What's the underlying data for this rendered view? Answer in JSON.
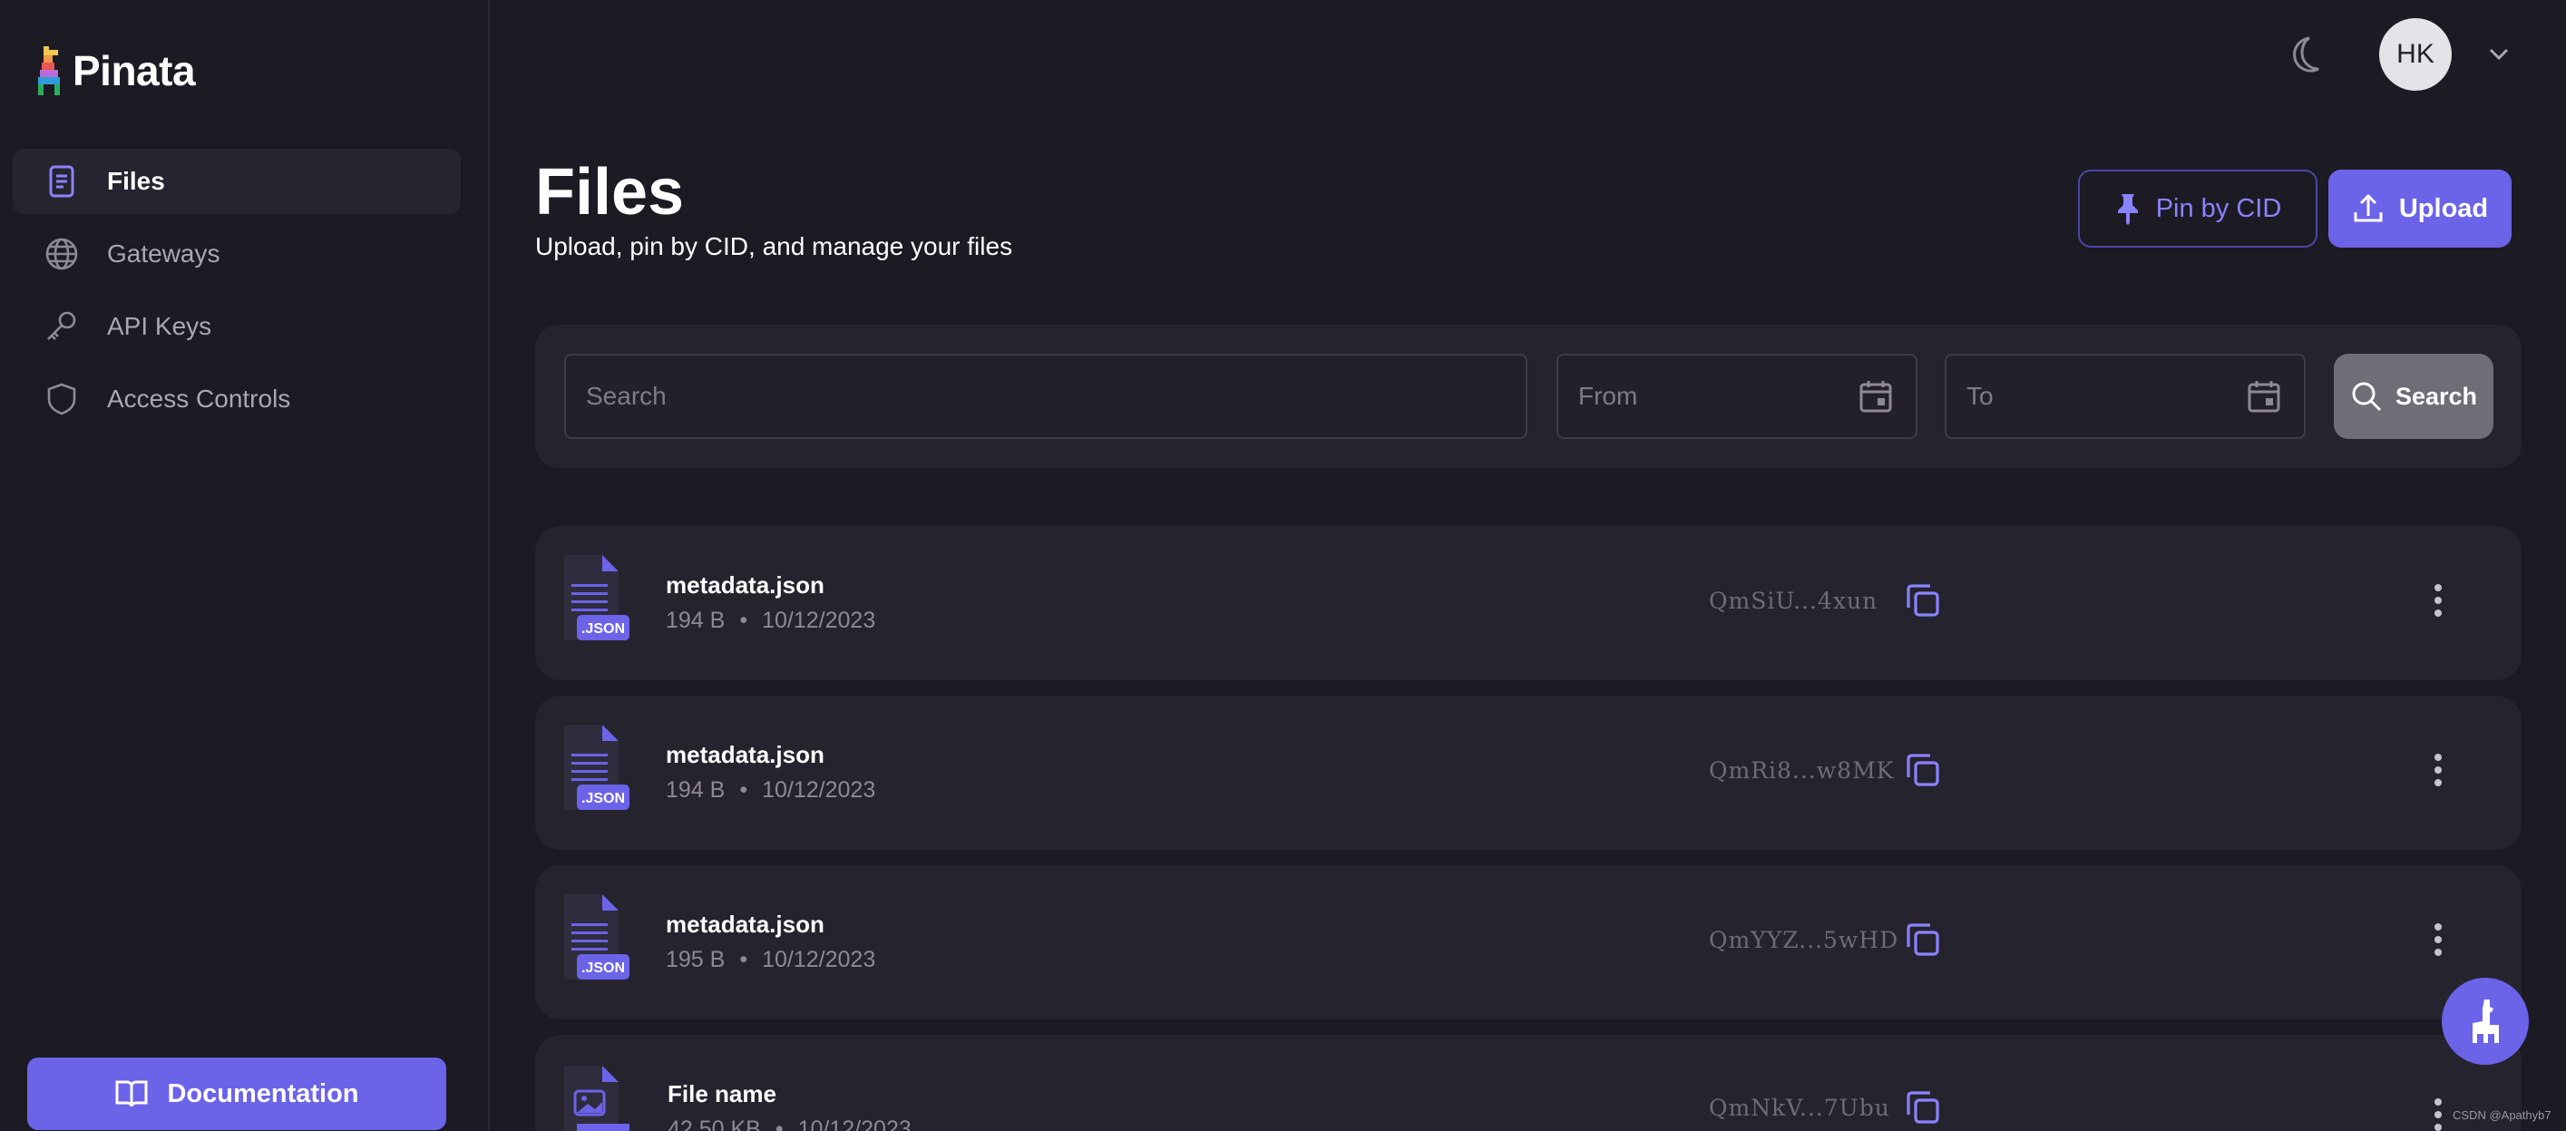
{
  "app": {
    "brand": "Pinata"
  },
  "sidebar": {
    "items": [
      {
        "label": "Files",
        "icon": "file-icon",
        "active": true
      },
      {
        "label": "Gateways",
        "icon": "globe-icon",
        "active": false
      },
      {
        "label": "API Keys",
        "icon": "key-icon",
        "active": false
      },
      {
        "label": "Access Controls",
        "icon": "shield-icon",
        "active": false
      }
    ],
    "documentation_label": "Documentation"
  },
  "header": {
    "avatar_initials": "HK",
    "theme_icon": "moon-icon"
  },
  "page": {
    "title": "Files",
    "subtitle": "Upload, pin by CID, and manage your files",
    "pin_button": "Pin by CID",
    "upload_button": "Upload"
  },
  "filters": {
    "search_placeholder": "Search",
    "from_placeholder": "From",
    "to_placeholder": "To",
    "search_button": "Search"
  },
  "files": [
    {
      "name": "metadata.json",
      "size": "194 B",
      "date": "10/12/2023",
      "cid": "QmSiU...4xun",
      "type_badge": ".JSON"
    },
    {
      "name": "metadata.json",
      "size": "194 B",
      "date": "10/12/2023",
      "cid": "QmRi8...w8MK",
      "type_badge": ".JSON"
    },
    {
      "name": "metadata.json",
      "size": "195 B",
      "date": "10/12/2023",
      "cid": "QmYYZ...5wHD",
      "type_badge": ".JSON"
    },
    {
      "name": "File name",
      "size": "42.50 KB",
      "date": "10/12/2023",
      "cid": "QmNkV...7Ubu",
      "type_badge": ""
    }
  ],
  "watermark": "CSDN @Apathyb7",
  "colors": {
    "accent": "#6b63e8",
    "background": "#1c1a23",
    "panel": "#25232d"
  }
}
